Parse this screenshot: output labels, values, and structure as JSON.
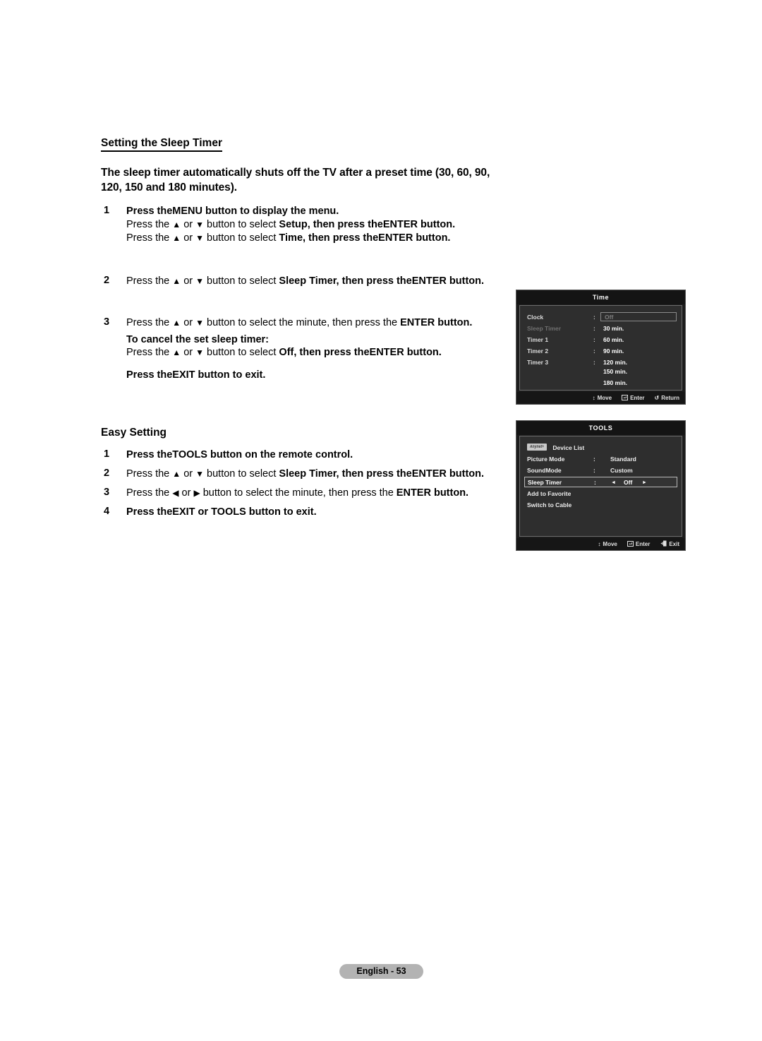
{
  "document": {
    "section_heading": "Setting the Sleep Timer",
    "intro": "The sleep timer automatically shuts off the TV after a preset time (30, 60, 90, 120, 150 and 180 minutes).",
    "steps_main": [
      {
        "num": "1",
        "lines": [
          {
            "style": "bold",
            "parts": [
              {
                "t": "Press the",
                "b": true
              },
              {
                "t": "MENU button to display the menu.",
                "b": true
              }
            ]
          },
          {
            "style": "mixed",
            "parts": [
              {
                "t": "Press the ",
                "b": false
              },
              {
                "t": "▲",
                "b": false
              },
              {
                "t": " or ",
                "b": false
              },
              {
                "t": "▼",
                "b": false
              },
              {
                "t": " button to select ",
                "b": false
              },
              {
                "t": "Setup, then press the",
                "b": true
              },
              {
                "t": "ENTER button.",
                "b": true
              }
            ]
          },
          {
            "style": "mixed",
            "parts": [
              {
                "t": "Press the ",
                "b": false
              },
              {
                "t": "▲",
                "b": false
              },
              {
                "t": " or ",
                "b": false
              },
              {
                "t": "▼",
                "b": false
              },
              {
                "t": " button to select ",
                "b": false
              },
              {
                "t": "Time, then press the",
                "b": true
              },
              {
                "t": "ENTER button.",
                "b": true
              }
            ]
          }
        ]
      },
      {
        "num": "2",
        "lines": [
          {
            "style": "mixed",
            "parts": [
              {
                "t": "Press the ",
                "b": false
              },
              {
                "t": "▲",
                "b": false
              },
              {
                "t": " or ",
                "b": false
              },
              {
                "t": "▼",
                "b": false
              },
              {
                "t": " button to select ",
                "b": false
              },
              {
                "t": "Sleep Timer, then press the",
                "b": true
              },
              {
                "t": "ENTER button.",
                "b": true
              }
            ]
          }
        ]
      },
      {
        "num": "3",
        "lines": [
          {
            "style": "mixed",
            "parts": [
              {
                "t": "Press the ",
                "b": false
              },
              {
                "t": "▲",
                "b": false
              },
              {
                "t": " or ",
                "b": false
              },
              {
                "t": "▼",
                "b": false
              },
              {
                "t": " button to select the minute, then press the ",
                "b": false
              },
              {
                "t": "ENTER button.",
                "b": true
              }
            ]
          },
          {
            "style": "bold",
            "parts": [
              {
                "t": "To cancel the set sleep timer:",
                "b": true
              }
            ]
          },
          {
            "style": "mixed",
            "parts": [
              {
                "t": "Press the ",
                "b": false
              },
              {
                "t": "▲",
                "b": false
              },
              {
                "t": " or ",
                "b": false
              },
              {
                "t": "▼",
                "b": false
              },
              {
                "t": " button to select ",
                "b": false
              },
              {
                "t": "Off, then press the",
                "b": true
              },
              {
                "t": "ENTER button.",
                "b": true
              }
            ]
          }
        ],
        "tail": "Press the EXIT button to exit."
      }
    ],
    "easy_setting": {
      "heading": "Easy Setting",
      "steps": [
        {
          "num": "1",
          "text_bold": "Press theTOOLS button on the remote control."
        },
        {
          "num": "2",
          "pre": "Press the ▲ or ▼ button to select ",
          "bold": "Sleep Timer, then press theENTER button."
        },
        {
          "num": "3",
          "pre": "Press the ◄ or ► button to select the minute, then press the ",
          "bold": "ENTER button."
        },
        {
          "num": "4",
          "text_bold": "Press theEXIT or TOOLS button to exit."
        }
      ]
    },
    "page_label": "English - 53"
  },
  "osd_time": {
    "title": "Time",
    "rows": [
      {
        "label": "Clock",
        "dim": false,
        "colon": ":"
      },
      {
        "label": "Sleep Timer",
        "dim": true,
        "colon": ":",
        "value": "30 min."
      },
      {
        "label": "Timer 1",
        "dim": false,
        "colon": ":",
        "value": "60 min."
      },
      {
        "label": "Timer 2",
        "dim": false,
        "colon": ":",
        "value": "90 min."
      },
      {
        "label": "Timer 3",
        "dim": false,
        "colon": ":",
        "value": "120 min."
      }
    ],
    "selected_value": "Off",
    "extra_values": [
      "150 min.",
      "180 min."
    ],
    "footer": [
      {
        "icon": "up-down-arrow-icon",
        "glyph": "↕",
        "label": "Move"
      },
      {
        "icon": "enter-key-icon",
        "glyph": "↵",
        "label": "Enter"
      },
      {
        "icon": "return-arrow-icon",
        "glyph": "↺",
        "label": "Return"
      }
    ]
  },
  "osd_tools": {
    "title": "TOOLS",
    "device_list": {
      "badge_text": "Anynet+",
      "label": "Device List"
    },
    "rows": [
      {
        "label": "Picture Mode",
        "colon": ":",
        "value": "Standard"
      },
      {
        "label": "SoundMode",
        "colon": ":",
        "value": "Custom"
      }
    ],
    "selected": {
      "label": "Sleep Timer",
      "colon": ":",
      "left_arrow": "◄",
      "value": "Off",
      "right_arrow": "►"
    },
    "plain_rows": [
      "Add to Favorite",
      "Switch to Cable"
    ],
    "footer": [
      {
        "icon": "up-down-arrow-icon",
        "glyph": "↕",
        "label": "Move"
      },
      {
        "icon": "enter-key-icon",
        "glyph": "↵",
        "label": "Enter"
      },
      {
        "icon": "exit-door-icon",
        "glyph": "⬅",
        "label": "Exit"
      }
    ]
  }
}
